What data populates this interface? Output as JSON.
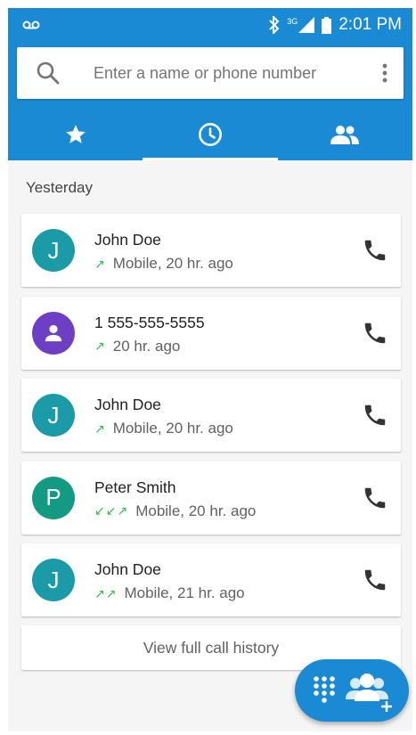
{
  "status_bar": {
    "voicemail_icon": "voicemail-icon",
    "network": "3G",
    "time": "2:01 PM"
  },
  "search": {
    "placeholder": "Enter a name or phone number"
  },
  "tabs": [
    {
      "icon": "star-icon",
      "active": false
    },
    {
      "icon": "clock-icon",
      "active": true
    },
    {
      "icon": "people-icon",
      "active": false
    }
  ],
  "section_title": "Yesterday",
  "calls": [
    {
      "name": "John Doe",
      "avatar_letter": "J",
      "avatar_color": "#1b9aa8",
      "arrows": "↗",
      "detail": "Mobile, 20 hr. ago"
    },
    {
      "name": "1 555-555-5555",
      "avatar_letter": "",
      "avatar_color": "#6c3fc4",
      "arrows": "↗",
      "detail": "20 hr. ago"
    },
    {
      "name": "John Doe",
      "avatar_letter": "J",
      "avatar_color": "#1b9aa8",
      "arrows": "↗",
      "detail": "Mobile, 20 hr. ago"
    },
    {
      "name": "Peter Smith",
      "avatar_letter": "P",
      "avatar_color": "#139a83",
      "arrows": "↙↙↗",
      "detail": "Mobile, 20 hr. ago"
    },
    {
      "name": "John Doe",
      "avatar_letter": "J",
      "avatar_color": "#1b9aa8",
      "arrows": "↗↗",
      "detail": "Mobile, 21 hr. ago"
    }
  ],
  "history_button": "View full call history",
  "colors": {
    "accent": "#1a8ad4",
    "outgoing_arrow": "#2fbf52"
  }
}
